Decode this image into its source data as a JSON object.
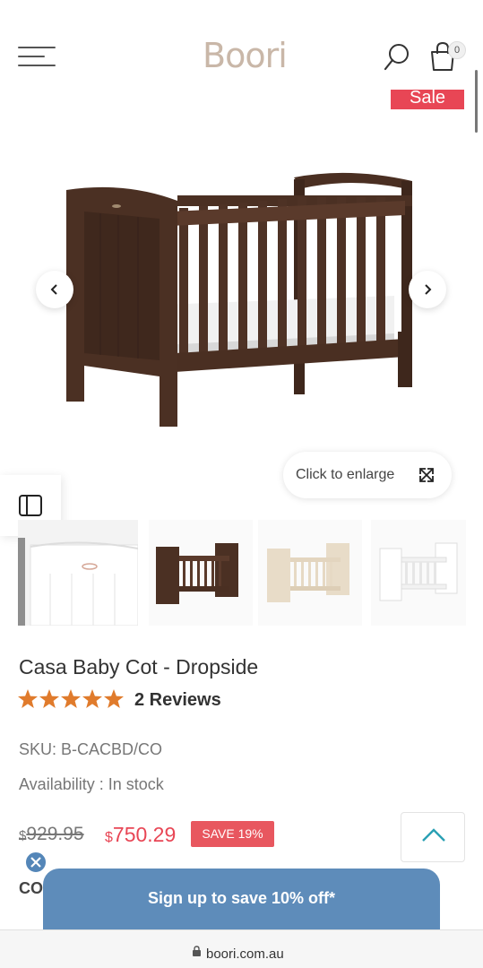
{
  "header": {
    "logo": "Boori",
    "cart_count": "0"
  },
  "badges": {
    "sale": "Sale",
    "save": "SAVE 19%"
  },
  "gallery": {
    "enlarge_label": "Click to enlarge",
    "thumbnails": [
      "white-cot-detail",
      "dark-wood-cot",
      "almond-cot",
      "white-cot"
    ]
  },
  "product": {
    "title": "Casa Baby Cot - Dropside",
    "rating": 5,
    "reviews": "2 Reviews",
    "sku": "SKU: B-CACBD/CO",
    "availability": "Availability : In stock",
    "currency_symbol": "$",
    "old_price": "929.95",
    "new_price": "750.29",
    "cut_off_label": "CO"
  },
  "popup": {
    "signup": "Sign up to save 10% off*"
  },
  "browser": {
    "url": "boori.com.au"
  },
  "colors": {
    "sale_red": "#e84655",
    "star_orange": "#e07b2c",
    "signup_blue": "#5e8cba",
    "logo_tan": "#c9b7a8"
  }
}
